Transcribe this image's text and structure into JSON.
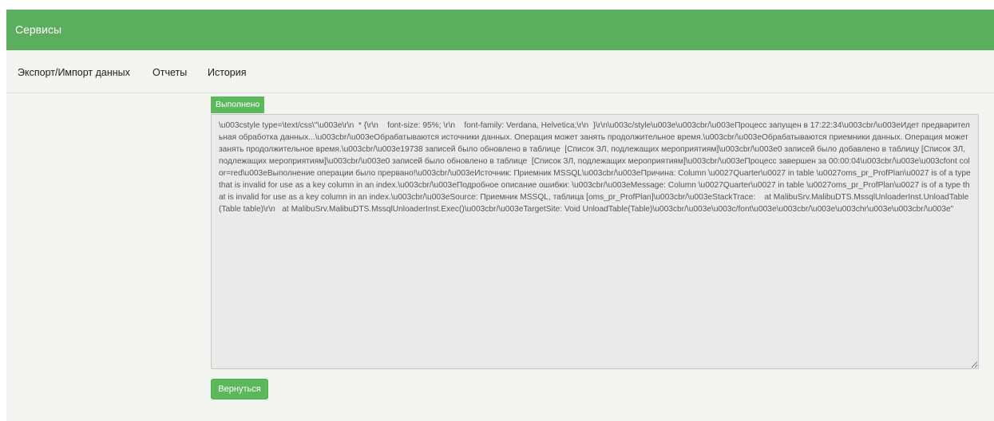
{
  "header": {
    "title": "Сервисы"
  },
  "nav": {
    "items": [
      {
        "label": "Экспорт/Импорт данных"
      },
      {
        "label": "Отчеты"
      },
      {
        "label": "История"
      }
    ]
  },
  "status": {
    "label": "Выполнено",
    "color": "#5cb85c"
  },
  "log": {
    "text": "\\u003cstyle type=\\text/css\\\"\\u003e\\r\\n  * {\\r\\n    font-size: 95%; \\r\\n    font-family: Verdana, Helvetica;\\r\\n  }\\r\\n\\u003c/style\\u003e\\u003cbr/\\u003eПроцесс запущен в 17:22:34\\u003cbr/\\u003eИдет предварительная обработка данных...\\u003cbr/\\u003eОбрабатываются источники данных. Операция может занять продолжительное время.\\u003cbr/\\u003eОбрабатываются приемники данных. Операция может занять продолжительное время.\\u003cbr/\\u003e19738 записей было обновлено в таблице  [Список ЗЛ, подлежащих мероприятиям]\\u003cbr/\\u003e0 записей было добавлено в таблицу [Список ЗЛ, подлежащих мероприятиям]\\u003cbr/\\u003e0 записей было обновлено в таблице  [Список ЗЛ, подлежащих мероприятиям]\\u003cbr/\\u003eПроцесс завершен за 00:00:04\\u003cbr/\\u003e\\u003cfont color=red\\u003eВыполнение операции было прервано!\\u003cbr/\\u003eИсточник: Приемник MSSQL\\u003cbr/\\u003eПричина: Column \\u0027Quarter\\u0027 in table \\u0027oms_pr_ProfPlan\\u0027 is of a type that is invalid for use as a key column in an index.\\u003cbr/\\u003eПодробное описание ошибки: \\u003cbr/\\u003eMessage: Column \\u0027Quarter\\u0027 in table \\u0027oms_pr_ProfPlan\\u0027 is of a type that is invalid for use as a key column in an index.\\u003cbr/\\u003eSource: Приемник MSSQL, таблица [oms_pr_ProfPlan]\\u003cbr/\\u003eStackTrace:    at MalibuSrv.MalibuDTS.MssqlUnloaderInst.UnloadTable(Table table)\\r\\n   at MalibuSrv.MalibuDTS.MssqlUnloaderInst.Exec()\\u003cbr/\\u003eTargetSite: Void UnloadTable(Table)\\u003cbr/\\u003e\\u003c/font\\u003e\\u003cbr/\\u003e\\u003chr\\u003e\\u003cbr/\\u003e\""
  },
  "actions": {
    "back_label": "Вернуться"
  },
  "colors": {
    "header_bg": "#5cae5f",
    "page_bg": "#f2f4ef",
    "accent": "#5cb85c"
  }
}
